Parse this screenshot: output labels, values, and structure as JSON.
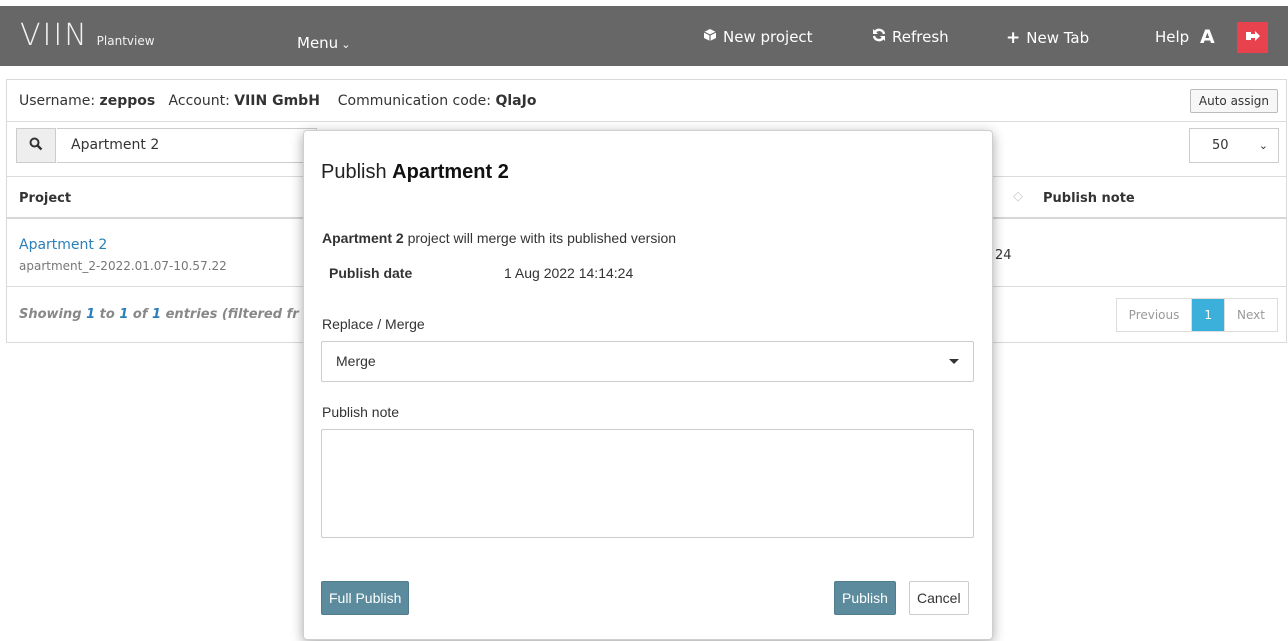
{
  "navbar": {
    "brand_logo": "VIIN",
    "brand_sub": "Plantview",
    "menu_label": "Menu",
    "new_project": "New project",
    "refresh": "Refresh",
    "new_tab": "New Tab",
    "help": "Help",
    "user_initial": "A"
  },
  "info": {
    "username_label": "Username:",
    "username": "zeppos",
    "account_label": "Account:",
    "account": "VIIN GmbH",
    "code_label": "Communication code:",
    "code": "QlaJo",
    "auto_assign": "Auto assign"
  },
  "search": {
    "value": "Apartment 2",
    "page_size": "50"
  },
  "table": {
    "headers": {
      "project": "Project",
      "publish_note": "Publish note"
    },
    "rows": [
      {
        "name": "Apartment 2",
        "sub": "apartment_2-2022.01.07-10.57.22",
        "tail": "24"
      }
    ],
    "showing": {
      "prefix": "Showing ",
      "from": "1",
      "to_word": " to ",
      "to": "1",
      "of_word": " of ",
      "total": "1",
      "suffix": " entries (filtered fr"
    },
    "pager": {
      "previous": "Previous",
      "current": "1",
      "next": "Next"
    }
  },
  "modal": {
    "title_prefix": "Publish ",
    "title_name": "Apartment 2",
    "merge_line_name": "Apartment 2",
    "merge_line_rest": " project will merge with its published version",
    "publish_date_label": "Publish date",
    "publish_date_value": "1 Aug 2022 14:14:24",
    "replace_merge_label": "Replace / Merge",
    "replace_merge_value": "Merge",
    "publish_note_label": "Publish note",
    "publish_note_value": "",
    "full_publish": "Full Publish",
    "publish": "Publish",
    "cancel": "Cancel"
  },
  "colors": {
    "navbar": "#676767",
    "logout": "#e8424f",
    "link": "#2b7fb8",
    "pager_active": "#3ab0db",
    "modal_button": "#5b8b9c"
  },
  "icons": {
    "new_project": "cube-icon",
    "refresh": "refresh-icon",
    "new_tab": "plus-icon",
    "logout": "logout-icon",
    "search": "search-icon"
  }
}
